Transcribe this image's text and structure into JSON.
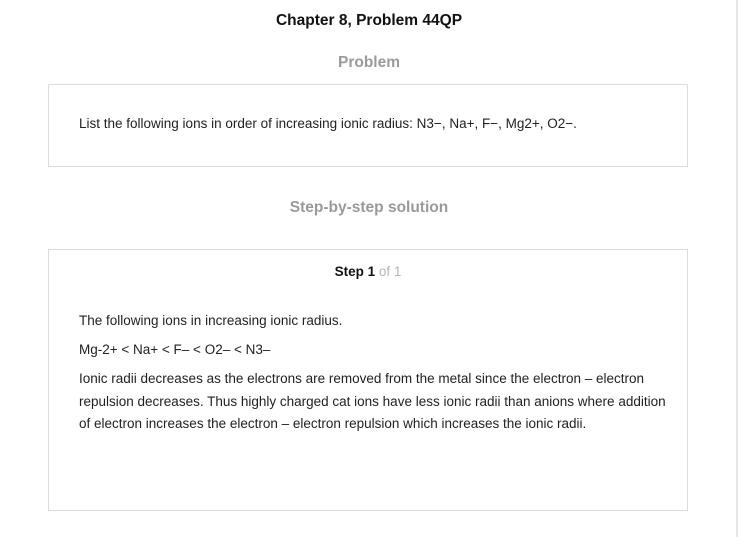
{
  "header": {
    "chapter_title": "Chapter 8, Problem 44QP"
  },
  "problem": {
    "heading": "Problem",
    "text": "List the following ions in order of increasing ionic radius: N3−, Na+, F−, Mg2+, O2−."
  },
  "solution": {
    "heading": "Step-by-step solution",
    "step_word": "Step 1",
    "step_of": " of 1",
    "line1": "The following ions in increasing ionic radius.",
    "line2": "Mg-2+ < Na+ < F– < O2– < N3–",
    "paragraph": "Ionic radii decreases as the electrons are removed from the metal since the electron – electron repulsion decreases. Thus highly charged cat ions have less ionic radii than anions where addition of electron increases the electron – electron repulsion which increases the ionic radii."
  }
}
